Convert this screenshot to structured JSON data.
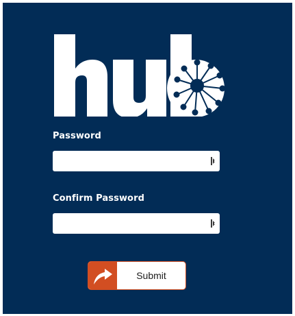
{
  "brand": {
    "logo_text": "hub",
    "primary_color": "#022c56",
    "accent_color": "#d24e22"
  },
  "form": {
    "password": {
      "label": "Password",
      "value": "",
      "icon": "password-reveal-icon"
    },
    "confirm_password": {
      "label": "Confirm Password",
      "value": "",
      "icon": "password-reveal-icon"
    },
    "submit": {
      "label": "Submit",
      "icon": "curved-arrow-icon"
    }
  }
}
